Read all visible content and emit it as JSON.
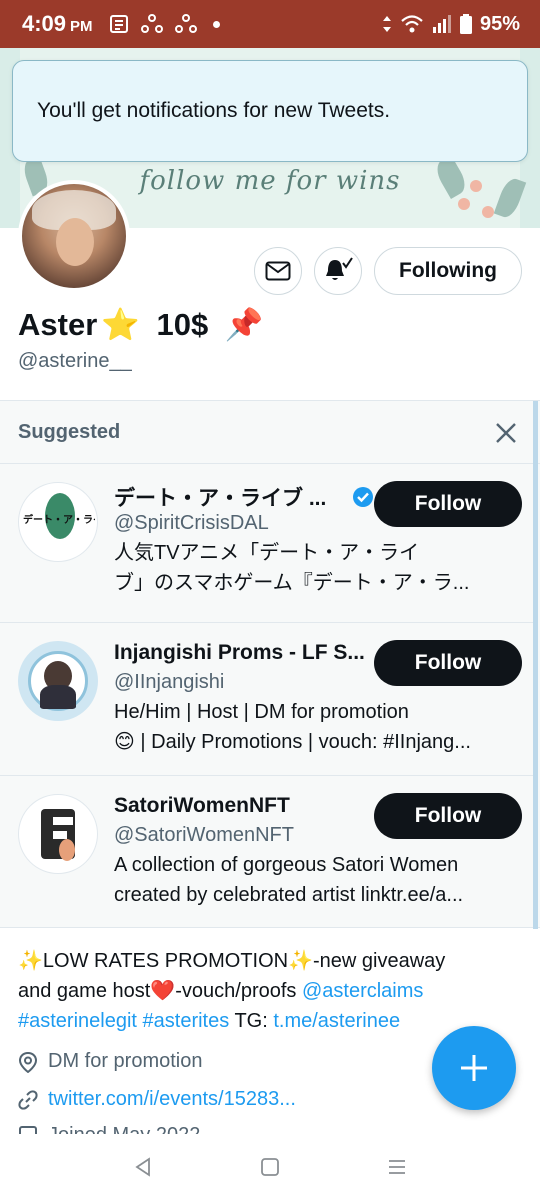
{
  "status_bar": {
    "time": "4:09",
    "ampm": "PM",
    "battery": "95%"
  },
  "banner": {
    "text": "follow me for wins"
  },
  "toast": {
    "message": "You'll get notifications for new Tweets."
  },
  "profile": {
    "name": "Aster",
    "name_suffix": "10$",
    "star_emoji": "⭐",
    "pin_emoji": "📌",
    "handle": "@asterine__",
    "following_label": "Following",
    "bio_line1_a": "✨LOW RATES PROMOTION✨-new giveaway",
    "bio_line2_a": "and game host",
    "bio_heart": "❤️",
    "bio_line2_b": "-vouch/proofs ",
    "bio_mention": "@asterclaims",
    "bio_tag1": "#asterinelegit",
    "bio_tag2": "#asterites",
    "bio_tg_label": " TG: ",
    "bio_tg_link": "t.me/asterinee",
    "location": "DM for promotion",
    "website": "twitter.com/i/events/15283...",
    "joined_partial": "Joined May 2022"
  },
  "suggested": {
    "title": "Suggested",
    "users": [
      {
        "name": "デート・ア・ライブ ...",
        "handle": "@SpiritCrisisDAL",
        "bio1": "人気TVアニメ「デート・ア・ライ",
        "bio2": "ブ」のスマホゲーム『デート・ア・ラ...",
        "follow_label": "Follow",
        "verified": true,
        "avatar_text": "デート・ア・ライブ"
      },
      {
        "name": "Injangishi Proms - LF S...",
        "handle": "@IInjangishi",
        "bio1": "He/Him | Host | DM for promotion",
        "bio2": "😊 | Daily Promotions | vouch: #IInjang...",
        "follow_label": "Follow",
        "verified": false
      },
      {
        "name": "SatoriWomenNFT",
        "handle": "@SatoriWomenNFT",
        "bio1": "A collection of gorgeous Satori Women",
        "bio2": "created by celebrated artist linktr.ee/a...",
        "follow_label": "Follow",
        "verified": false
      }
    ]
  },
  "colors": {
    "status_bar": "#9b3a2a",
    "accent": "#1d9bf0",
    "follow_bg": "#0f1419",
    "secondary_text": "#536471"
  }
}
